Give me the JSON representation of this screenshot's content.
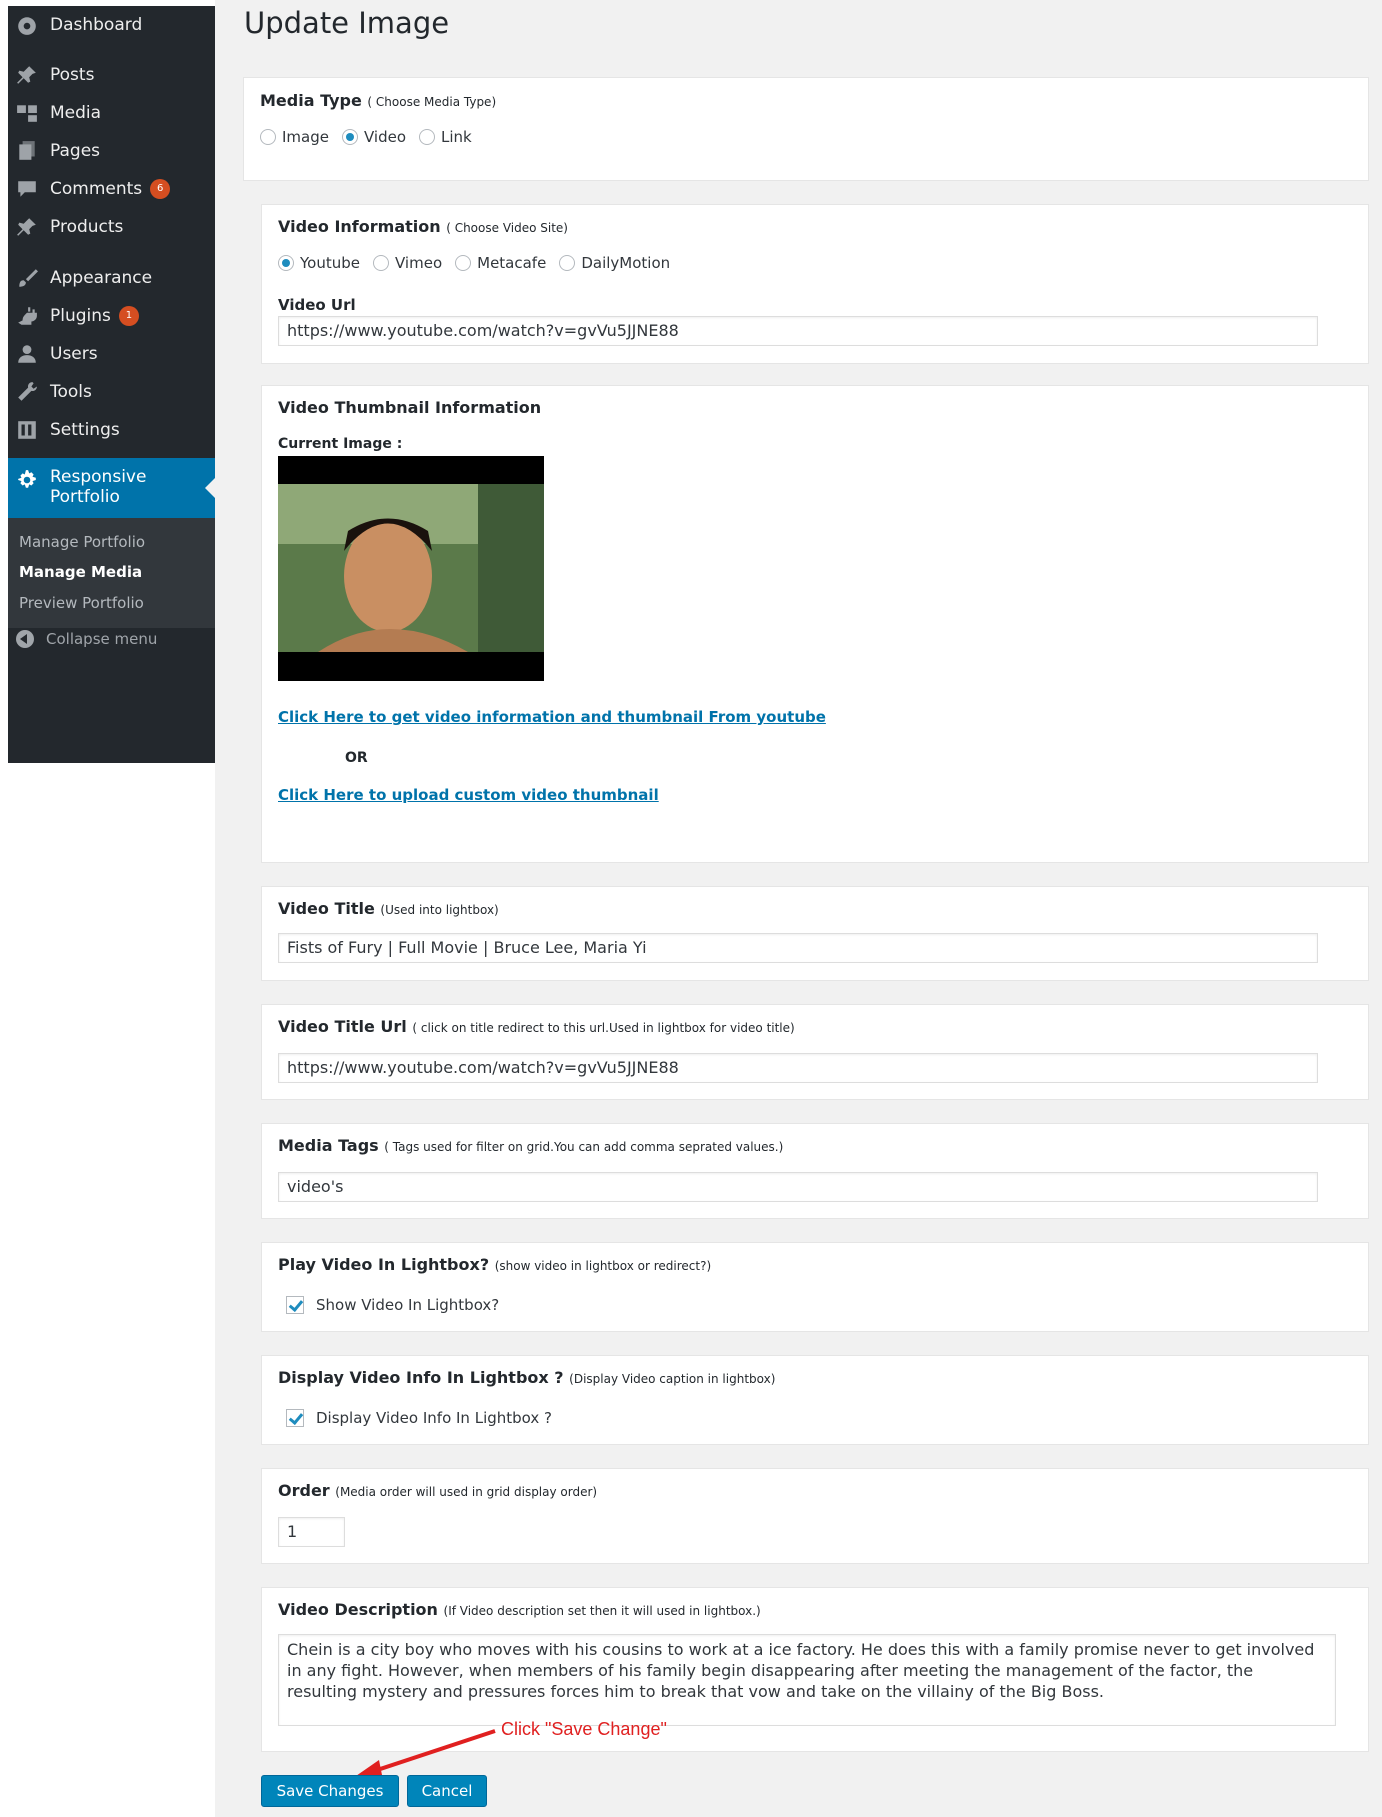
{
  "sidebar": {
    "items": [
      {
        "label": "Dashboard",
        "icon": "dashboard-icon"
      },
      {
        "label": "Posts",
        "icon": "pin-icon"
      },
      {
        "label": "Media",
        "icon": "media-icon"
      },
      {
        "label": "Pages",
        "icon": "pages-icon"
      },
      {
        "label": "Comments",
        "icon": "comment-icon",
        "badge": "6"
      },
      {
        "label": "Products",
        "icon": "pin-icon"
      },
      {
        "label": "Appearance",
        "icon": "brush-icon"
      },
      {
        "label": "Plugins",
        "icon": "plugin-icon",
        "badge": "1"
      },
      {
        "label": "Users",
        "icon": "user-icon"
      },
      {
        "label": "Tools",
        "icon": "wrench-icon"
      },
      {
        "label": "Settings",
        "icon": "settings-icon"
      }
    ],
    "current": {
      "label_line1": "Responsive",
      "label_line2": "Portfolio",
      "icon": "gear-icon"
    },
    "submenu": [
      "Manage Portfolio",
      "Manage Media",
      "Preview Portfolio"
    ],
    "collapse_label": "Collapse menu"
  },
  "page": {
    "title": "Update Image"
  },
  "media_type": {
    "label": "Media Type",
    "hint": "( Choose Media Type)",
    "options": [
      "Image",
      "Video",
      "Link"
    ],
    "selected": "Video"
  },
  "video_info": {
    "label": "Video Information",
    "hint": "( Choose Video Site)",
    "sites": [
      "Youtube",
      "Vimeo",
      "Metacafe",
      "DailyMotion"
    ],
    "selected": "Youtube",
    "url_label": "Video Url",
    "url_value": "https://www.youtube.com/watch?v=gvVu5JJNE88"
  },
  "thumbnail": {
    "label": "Video Thumbnail Information",
    "current_label": "Current Image :",
    "get_link": "Click Here to get video information and thumbnail From youtube",
    "or": "OR",
    "upload_link": "Click Here to upload custom video thumbnail"
  },
  "video_title": {
    "label": "Video Title",
    "hint": "(Used into lightbox)",
    "value": "Fists of Fury | Full Movie | Bruce Lee, Maria Yi"
  },
  "video_title_url": {
    "label": "Video Title Url",
    "hint": "( click on title redirect to this url.Used in lightbox for video title)",
    "value": "https://www.youtube.com/watch?v=gvVu5JJNE88"
  },
  "media_tags": {
    "label": "Media Tags",
    "hint": "( Tags used for filter on grid.You can add comma seprated values.)",
    "value": "video's"
  },
  "play_lightbox": {
    "label": "Play Video In Lightbox?",
    "hint": "(show video in lightbox or redirect?)",
    "checkbox_label": "Show Video In Lightbox?",
    "checked": true
  },
  "display_info": {
    "label": "Display Video Info In Lightbox ?",
    "hint": "(Display Video caption in lightbox)",
    "checkbox_label": "Display Video Info In Lightbox ?",
    "checked": true
  },
  "order": {
    "label": "Order",
    "hint": "(Media order will used in grid display order)",
    "value": "1"
  },
  "description": {
    "label": "Video Description",
    "hint": "(If Video description set then it will used in lightbox.)",
    "value": "Chein is a city boy who moves with his cousins to work at a ice factory. He does this with a family promise never to get involved in any fight. However, when members of his family begin disappearing after meeting the management of the factor, the resulting mystery and pressures forces him to break that vow and take on the villainy of the Big Boss."
  },
  "actions": {
    "save": "Save Changes",
    "cancel": "Cancel"
  },
  "annotation": {
    "text": "Click \"Save Change\""
  },
  "colors": {
    "accent": "#0073aa",
    "button": "#0085ba",
    "annotation": "#e02020"
  }
}
